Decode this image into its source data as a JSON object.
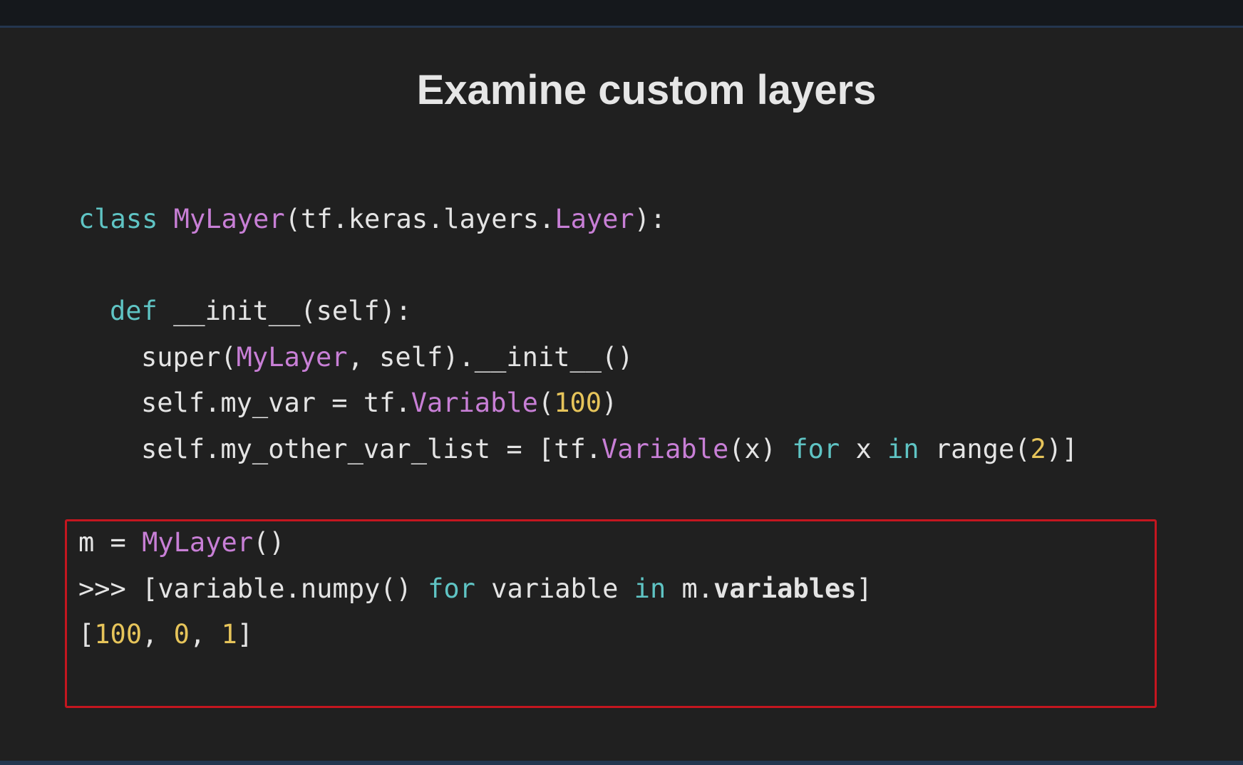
{
  "slide": {
    "title": "Examine custom layers"
  },
  "code": {
    "line1": {
      "kw_class": "class",
      "sp1": " ",
      "name": "MyLayer",
      "open": "(tf.keras.layers.",
      "base": "Layer",
      "close": "):"
    },
    "line2": {
      "kw_def": "def",
      "rest": " __init__(self):"
    },
    "line3": {
      "pre": "super(",
      "cls": "MyLayer",
      "post": ", self).__init__()"
    },
    "line4": {
      "pre": "self.my_var = tf.",
      "cls": "Variable",
      "open": "(",
      "num": "100",
      "close": ")"
    },
    "line5": {
      "pre": "self.my_other_var_list = [tf.",
      "cls": "Variable",
      "mid1": "(x) ",
      "kw_for": "for",
      "mid2": " x ",
      "kw_in": "in",
      "mid3": " range(",
      "num": "2",
      "close": ")]"
    }
  },
  "console": {
    "line1": {
      "pre": "m = ",
      "cls": "MyLayer",
      "post": "()"
    },
    "line2": {
      "pre": ">>> [variable.numpy() ",
      "kw_for": "for",
      "mid": " variable ",
      "kw_in": "in",
      "mid2": " m.",
      "attr": "variables",
      "close": "]"
    },
    "line3": {
      "open": "[",
      "n1": "100",
      "sep1": ", ",
      "n2": "0",
      "sep2": ", ",
      "n3": "1",
      "close": "]"
    }
  },
  "colors": {
    "background": "#202020",
    "keyword": "#5fc4c4",
    "class_name": "#c87fd6",
    "number": "#e6c45a",
    "text": "#e4e4e4",
    "highlight_border": "#c4161f"
  }
}
